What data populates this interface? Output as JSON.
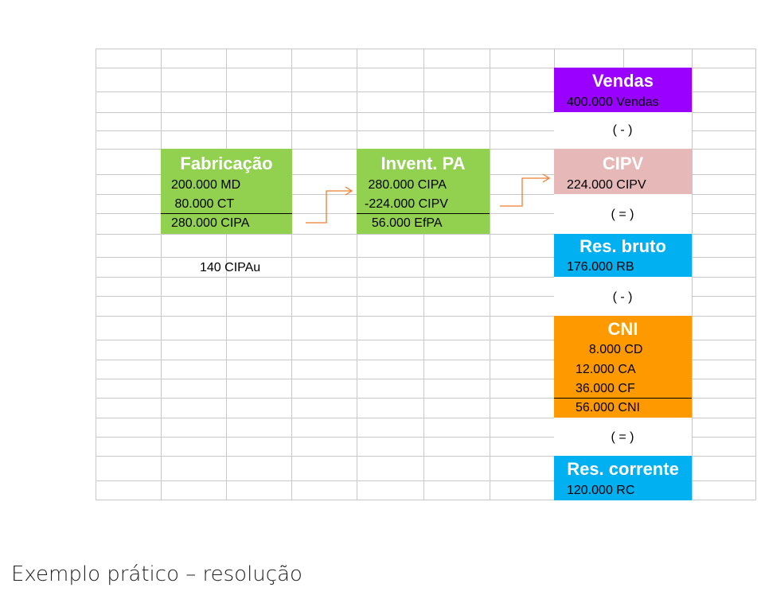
{
  "fabricacao": {
    "title": "Fabricação",
    "lines": [
      "200.000 MD",
      " 80.000 CT",
      "280.000 CIPA"
    ]
  },
  "inventario": {
    "title": "Invent. PA",
    "lines": [
      " 280.000 CIPA",
      "-224.000 CIPV",
      "  56.000 EfPA"
    ]
  },
  "cipau": "140 CIPAu",
  "vendas": {
    "title": "Vendas",
    "line": "400.000 Vendas"
  },
  "op_minus_1": "( - )",
  "cipv": {
    "title": "CIPV",
    "line": "224.000 CIPV"
  },
  "op_equal_1": "( = )",
  "res_bruto": {
    "title": "Res. bruto",
    "line": "176.000 RB"
  },
  "op_minus_2": "( - )",
  "cni": {
    "title": "CNI",
    "lines": [
      "  8.000 CD",
      "12.000 CA",
      "36.000 CF",
      "56.000 CNI"
    ]
  },
  "op_equal_2": "( = )",
  "res_corrente": {
    "title": "Res. corrente",
    "line": "120.000 RC"
  },
  "caption": "Exemplo prático – resolução",
  "colors": {
    "green": "#92d050",
    "purple": "#9900ff",
    "pink": "#e6b8b7",
    "blue": "#00b0f0",
    "orange": "#ff9900",
    "arrow": "#ed7d31"
  }
}
